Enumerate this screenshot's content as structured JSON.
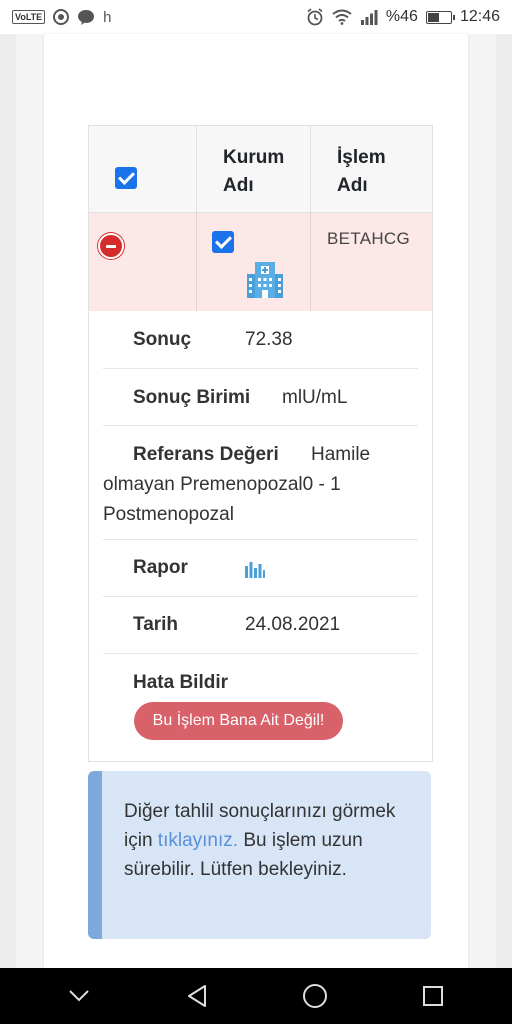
{
  "status_bar": {
    "volte": "VoLTE",
    "notif_letter": "h",
    "battery_percent": "%46",
    "battery_level": 0.46,
    "time": "12:46"
  },
  "table": {
    "headers": {
      "kurum": "Kurum Adı",
      "islem": "İşlem Adı"
    },
    "select_all_checked": true,
    "row": {
      "checked": true,
      "islem_adi": "BETAHCG",
      "kurum_icon": "hospital-icon"
    }
  },
  "details": {
    "sonuc_label": "Sonuç",
    "sonuc_value": "72.38",
    "birim_label": "Sonuç Birimi",
    "birim_value": "mlU/mL",
    "referans_label": "Referans Değeri",
    "referans_value_1": "Hamile",
    "referans_value_2": "olmayan Premenopozal0 - 1",
    "referans_value_3": "Postmenopozal",
    "rapor_label": "Rapor",
    "rapor_icon": "bar-chart-icon",
    "tarih_label": "Tarih",
    "tarih_value": "24.08.2021",
    "hata_label": "Hata Bildir",
    "hata_button": "Bu İşlem Bana Ait Değil!"
  },
  "info": {
    "text_before": "Diğer tahlil sonuçlarınızı görmek için ",
    "link": "tıklayınız.",
    "text_after": " Bu işlem uzun sürebilir. Lütfen bekleyiniz."
  },
  "colors": {
    "checkbox": "#1a73e8",
    "row_highlight": "#fde8e8",
    "remove_button": "#d62b2b",
    "error_button": "#d9616a",
    "info_bg": "#d7e5f6",
    "info_border": "#7ea9dd",
    "link": "#5b8fd6",
    "icon_blue": "#4a9fd8"
  },
  "nav": {
    "back_icon": "back-icon",
    "home_icon": "home-icon",
    "recents_icon": "recents-icon",
    "collapse_icon": "chevron-down-icon"
  }
}
